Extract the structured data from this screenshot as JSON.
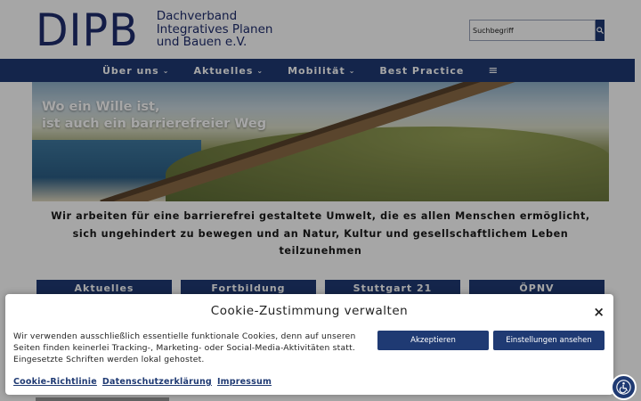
{
  "header": {
    "logo_mark": "DIPB",
    "logo_line1": "Dachverband",
    "logo_line2": "Integratives Planen",
    "logo_line3": "und Bauen e.V.",
    "search_placeholder": "Suchbegriff",
    "search_icon": "search-icon"
  },
  "nav": {
    "items": [
      {
        "label": "Über uns",
        "has_dropdown": true
      },
      {
        "label": "Aktuelles",
        "has_dropdown": true
      },
      {
        "label": "Mobilität",
        "has_dropdown": true
      },
      {
        "label": "Best Practice",
        "has_dropdown": false
      }
    ],
    "menu_icon": "hamburger-icon"
  },
  "hero": {
    "line1": "Wo ein Wille ist,",
    "line2": "ist auch ein barrierefreier Weg"
  },
  "intro": {
    "text": "Wir arbeiten für eine barrierefrei gestaltete Umwelt, die es allen Menschen ermöglicht, sich ungehindert zu bewegen und an Natur, Kultur und gesellschaftlichem Leben teilzunehmen"
  },
  "tiles": [
    "Aktuelles",
    "Fortbildung",
    "Stuttgart 21",
    "ÖPNV"
  ],
  "cookie": {
    "title": "Cookie-Zustimmung verwalten",
    "close_label": "×",
    "text": "Wir verwenden ausschließlich essentielle funktionale Cookies, denn auf unseren Seiten finden keinerlei Tracking-, Marketing- oder Social-Media-Aktivitäten statt. Eingesetzte Schriften werden lokal gehostet.",
    "accept_label": "Akzeptieren",
    "settings_label": "Einstellungen ansehen",
    "links": [
      "Cookie-Richtlinie",
      "Datenschutzerklärung",
      "Impressum"
    ]
  },
  "colors": {
    "brand": "#1f3a73",
    "logo": "#1f2d6e"
  },
  "accessibility_icon": "accessibility-icon"
}
